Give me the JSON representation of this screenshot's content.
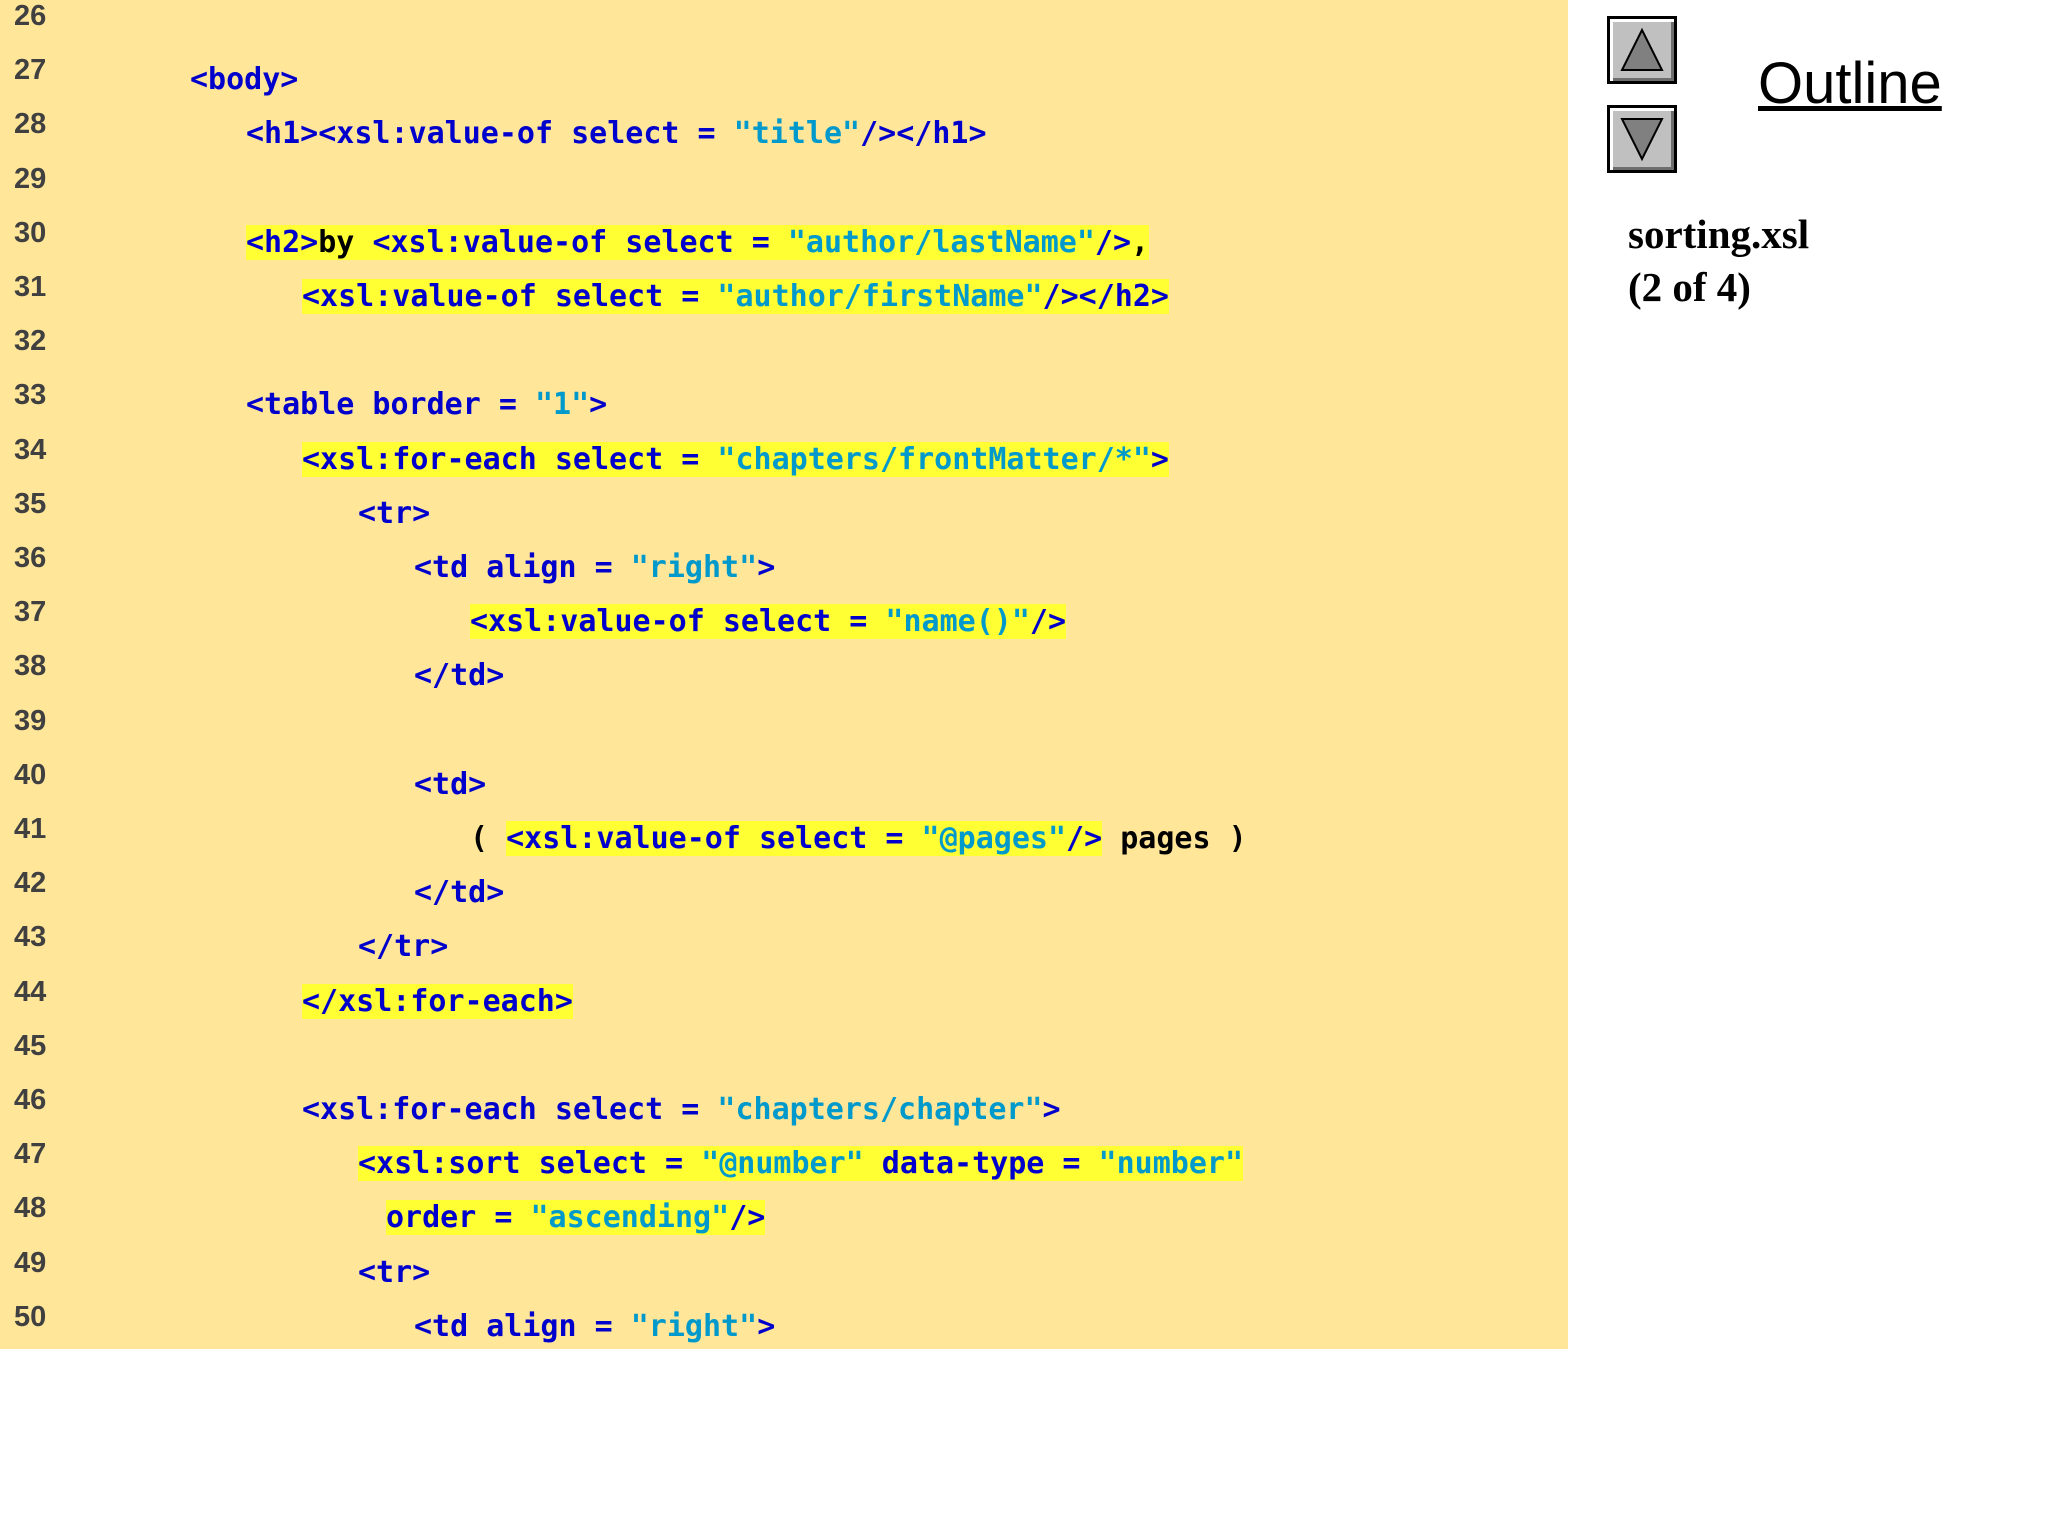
{
  "sidebar": {
    "outline_label": "Outline",
    "file_name": "sorting.xsl",
    "page_info": "(2 of 4)",
    "nav_up_icon": "triangle-up-icon",
    "nav_down_icon": "triangle-down-icon"
  },
  "colors": {
    "panel_background": "#FFE699",
    "highlight": "#FFFF33",
    "tag": "#0000CC",
    "string": "#0099CC",
    "text": "#000000",
    "line_number": "#404040"
  },
  "code": {
    "lines": [
      {
        "num": "26",
        "indent": 0,
        "tokens": []
      },
      {
        "num": "27",
        "indent": 1,
        "tokens": [
          {
            "t": "<body>",
            "k": "tag"
          }
        ]
      },
      {
        "num": "28",
        "indent": 2,
        "tokens": [
          {
            "t": "<h1><xsl:value-of select = ",
            "k": "tag"
          },
          {
            "t": "\"title\"",
            "k": "str"
          },
          {
            "t": "/></h1>",
            "k": "tag"
          }
        ]
      },
      {
        "num": "29",
        "indent": 0,
        "tokens": []
      },
      {
        "num": "30",
        "indent": 2,
        "tokens": [
          {
            "t": "<h2>",
            "k": "tag",
            "hl": true
          },
          {
            "t": "by ",
            "k": "txt",
            "hl": true
          },
          {
            "t": "<xsl:value-of select = ",
            "k": "tag",
            "hl": true
          },
          {
            "t": "\"author/lastName\"",
            "k": "str",
            "hl": true
          },
          {
            "t": "/>",
            "k": "tag",
            "hl": true
          },
          {
            "t": ",",
            "k": "txt",
            "hl": true
          }
        ]
      },
      {
        "num": "31",
        "indent": 3,
        "tokens": [
          {
            "t": "<xsl:value-of select = ",
            "k": "tag",
            "hl": true
          },
          {
            "t": "\"author/firstName\"",
            "k": "str",
            "hl": true
          },
          {
            "t": "/></h2>",
            "k": "tag",
            "hl": true
          }
        ]
      },
      {
        "num": "32",
        "indent": 0,
        "tokens": []
      },
      {
        "num": "33",
        "indent": 2,
        "tokens": [
          {
            "t": "<table border = ",
            "k": "tag"
          },
          {
            "t": "\"1\"",
            "k": "str"
          },
          {
            "t": ">",
            "k": "tag"
          }
        ]
      },
      {
        "num": "34",
        "indent": 3,
        "tokens": [
          {
            "t": "<xsl:for-each select = ",
            "k": "tag",
            "hl": true
          },
          {
            "t": "\"chapters/frontMatter/*\"",
            "k": "str",
            "hl": true
          },
          {
            "t": ">",
            "k": "tag",
            "hl": true
          }
        ]
      },
      {
        "num": "35",
        "indent": 4,
        "tokens": [
          {
            "t": "<tr>",
            "k": "tag"
          }
        ]
      },
      {
        "num": "36",
        "indent": 5,
        "tokens": [
          {
            "t": "<td align = ",
            "k": "tag"
          },
          {
            "t": "\"right\"",
            "k": "str"
          },
          {
            "t": ">",
            "k": "tag"
          }
        ]
      },
      {
        "num": "37",
        "indent": 6,
        "tokens": [
          {
            "t": "<xsl:value-of select = ",
            "k": "tag",
            "hl": true
          },
          {
            "t": "\"name()\"",
            "k": "str",
            "hl": true
          },
          {
            "t": "/>",
            "k": "tag",
            "hl": true
          }
        ]
      },
      {
        "num": "38",
        "indent": 5,
        "tokens": [
          {
            "t": "</td>",
            "k": "tag"
          }
        ]
      },
      {
        "num": "39",
        "indent": 0,
        "tokens": []
      },
      {
        "num": "40",
        "indent": 5,
        "tokens": [
          {
            "t": "<td>",
            "k": "tag"
          }
        ]
      },
      {
        "num": "41",
        "indent": 6,
        "tokens": [
          {
            "t": "( ",
            "k": "txt"
          },
          {
            "t": "<xsl:value-of select = ",
            "k": "tag",
            "hl": true
          },
          {
            "t": "\"@pages\"",
            "k": "str",
            "hl": true
          },
          {
            "t": "/>",
            "k": "tag",
            "hl": true
          },
          {
            "t": " pages )",
            "k": "txt"
          }
        ]
      },
      {
        "num": "42",
        "indent": 5,
        "tokens": [
          {
            "t": "</td>",
            "k": "tag"
          }
        ]
      },
      {
        "num": "43",
        "indent": 4,
        "tokens": [
          {
            "t": "</tr>",
            "k": "tag"
          }
        ]
      },
      {
        "num": "44",
        "indent": 3,
        "tokens": [
          {
            "t": "</xsl:for-each>",
            "k": "tag",
            "hl": true
          }
        ]
      },
      {
        "num": "45",
        "indent": 0,
        "tokens": []
      },
      {
        "num": "46",
        "indent": 3,
        "tokens": [
          {
            "t": "<xsl:for-each select = ",
            "k": "tag"
          },
          {
            "t": "\"chapters/chapter\"",
            "k": "str"
          },
          {
            "t": ">",
            "k": "tag"
          }
        ]
      },
      {
        "num": "47",
        "indent": 4,
        "tokens": [
          {
            "t": "<xsl:sort select = ",
            "k": "tag",
            "hl": true
          },
          {
            "t": "\"@number\"",
            "k": "str",
            "hl": true
          },
          {
            "t": " data-type = ",
            "k": "tag",
            "hl": true
          },
          {
            "t": "\"number\"",
            "k": "str",
            "hl": true
          }
        ]
      },
      {
        "num": "48",
        "indent": 4.5,
        "tokens": [
          {
            "t": "order = ",
            "k": "tag",
            "hl": true
          },
          {
            "t": "\"ascending\"",
            "k": "str",
            "hl": true
          },
          {
            "t": "/>",
            "k": "tag",
            "hl": true
          }
        ]
      },
      {
        "num": "49",
        "indent": 4,
        "tokens": [
          {
            "t": "<tr>",
            "k": "tag"
          }
        ]
      },
      {
        "num": "50",
        "indent": 5,
        "tokens": [
          {
            "t": "<td align = ",
            "k": "tag"
          },
          {
            "t": "\"right\"",
            "k": "str"
          },
          {
            "t": ">",
            "k": "tag"
          }
        ]
      }
    ]
  }
}
